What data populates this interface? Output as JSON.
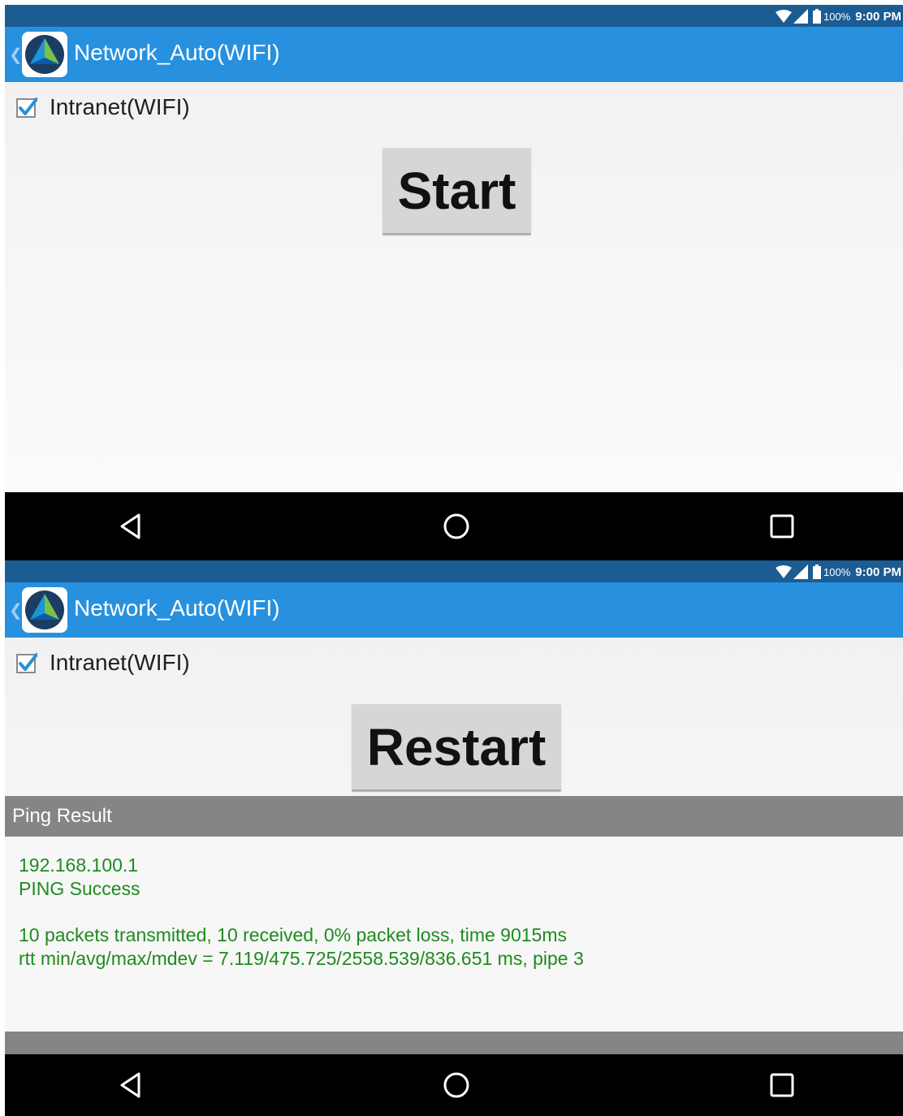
{
  "status_bar": {
    "battery": "100%",
    "time": "9:00 PM"
  },
  "app": {
    "title": "Network_Auto(WIFI)"
  },
  "checkbox": {
    "label": "Intranet(WIFI)",
    "checked": true
  },
  "screen1": {
    "button_label": "Start"
  },
  "screen2": {
    "button_label": "Restart",
    "ping_result": {
      "header": "Ping Result",
      "ip": "192.168.100.1",
      "status": "PING Success",
      "summary": "10 packets transmitted, 10 received, 0% packet loss, time 9015ms",
      "rtt": "rtt min/avg/max/mdev = 7.119/475.725/2558.539/836.651 ms, pipe 3"
    }
  },
  "icons": [
    "wifi-icon",
    "signal-icon",
    "battery-icon",
    "app-icon",
    "back-chevron-icon",
    "checkmark-icon",
    "nav-back-icon",
    "nav-home-icon",
    "nav-recents-icon"
  ],
  "colors": {
    "status_bar": "#1b5c92",
    "action_bar": "#2791df",
    "success_text": "#1f8a1f",
    "section_header": "#858585"
  }
}
